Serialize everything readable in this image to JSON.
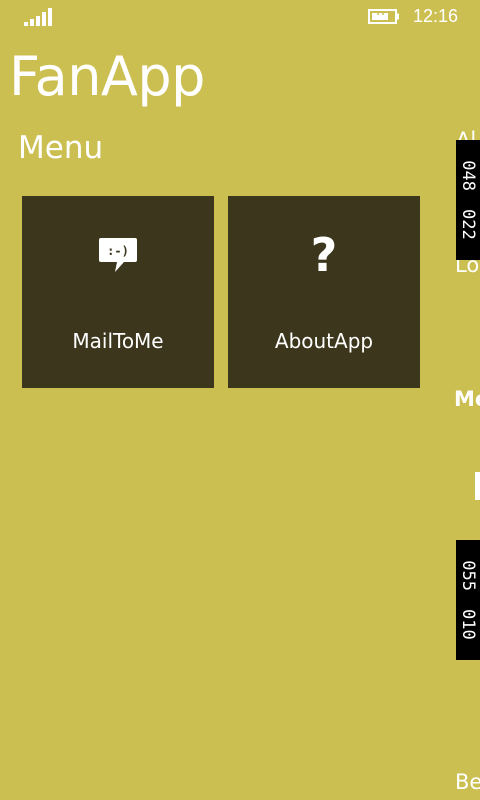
{
  "status_bar": {
    "time": "12:16"
  },
  "app": {
    "title": "FanApp"
  },
  "section": {
    "title": "Menu"
  },
  "tiles": [
    {
      "label": "MailToMe",
      "icon": "smiley-chat-bubble-icon"
    },
    {
      "label": "AboutApp",
      "icon": "question-mark-icon"
    }
  ],
  "peek": [
    "Al",
    "Lo",
    "Me",
    "Be"
  ],
  "ads": [
    {
      "a": "048",
      "b": "022"
    },
    {
      "a": "055",
      "b": "010"
    }
  ],
  "colors": {
    "background": "#CCBF52",
    "tile": "#3C371C",
    "text": "#FFFFFF"
  }
}
